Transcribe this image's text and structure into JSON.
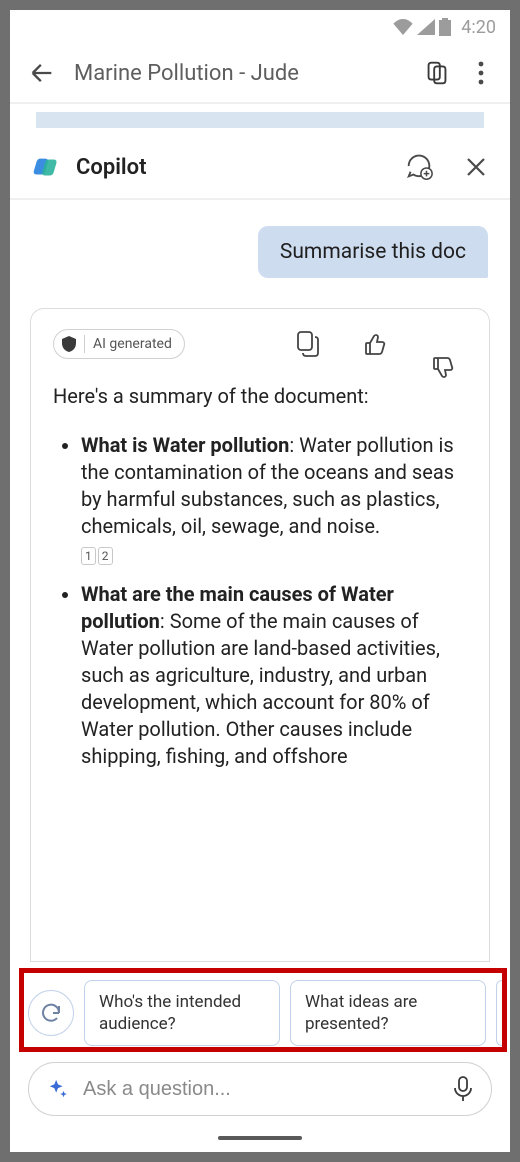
{
  "status": {
    "time": "4:20"
  },
  "header": {
    "doc_title": "Marine Pollution - Jude"
  },
  "copilot": {
    "title": "Copilot",
    "user_message": "Summarise this doc",
    "ai_badge": "AI generated",
    "summary_intro": "Here's a summary of the document:",
    "items": [
      {
        "heading": "What is Water pollution",
        "body": ": Water pollution is the contamination of the oceans and seas by harmful substances, such as plastics, chemicals, oil, sewage, and noise.",
        "refs": [
          "1",
          "2"
        ]
      },
      {
        "heading": "What are the main causes of Water pollution",
        "body": ": Some of the main causes of Water pollution are land-based activities, such as agriculture, industry, and urban development, which account for 80% of Water pollution. Other causes include shipping, fishing, and offshore",
        "refs": []
      }
    ],
    "suggestions": [
      "Who's the intended audience?",
      "What ideas are presented?"
    ],
    "input_placeholder": "Ask a question..."
  }
}
